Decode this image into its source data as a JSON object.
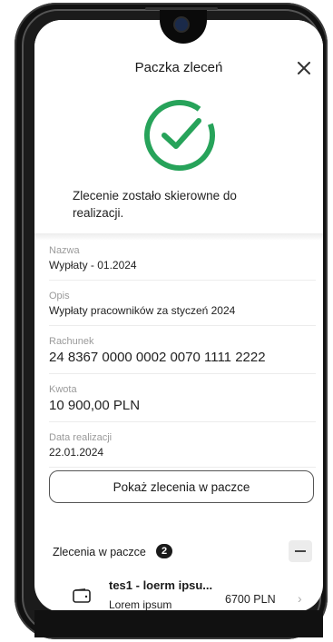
{
  "header": {
    "title": "Paczka zleceń",
    "close_icon": "close-icon"
  },
  "status": {
    "icon": "check-circle-icon",
    "accent_color": "#27a35a",
    "message": "Zlecenie zostało skierowne do realizacji."
  },
  "details": [
    {
      "label": "Nazwa",
      "value": "Wypłaty - 01.2024"
    },
    {
      "label": "Opis",
      "value": "Wypłaty pracowników za styczeń 2024"
    },
    {
      "label": "Rachunek",
      "value": "24 8367 0000 0002 0070 1111 2222"
    },
    {
      "label": "Kwota",
      "value": "10 900,00 PLN"
    },
    {
      "label": "Data realizacji",
      "value": "22.01.2024"
    }
  ],
  "show_button": {
    "label": "Pokaż zlecenia w paczce"
  },
  "orders_section": {
    "title": "Zlecenia w paczce",
    "count": "2",
    "items": [
      {
        "icon": "wallet-icon",
        "title": "tes1 - loerm ipsu...",
        "subtitle": "Lorem ipsum",
        "amount": "6700 PLN"
      }
    ]
  }
}
